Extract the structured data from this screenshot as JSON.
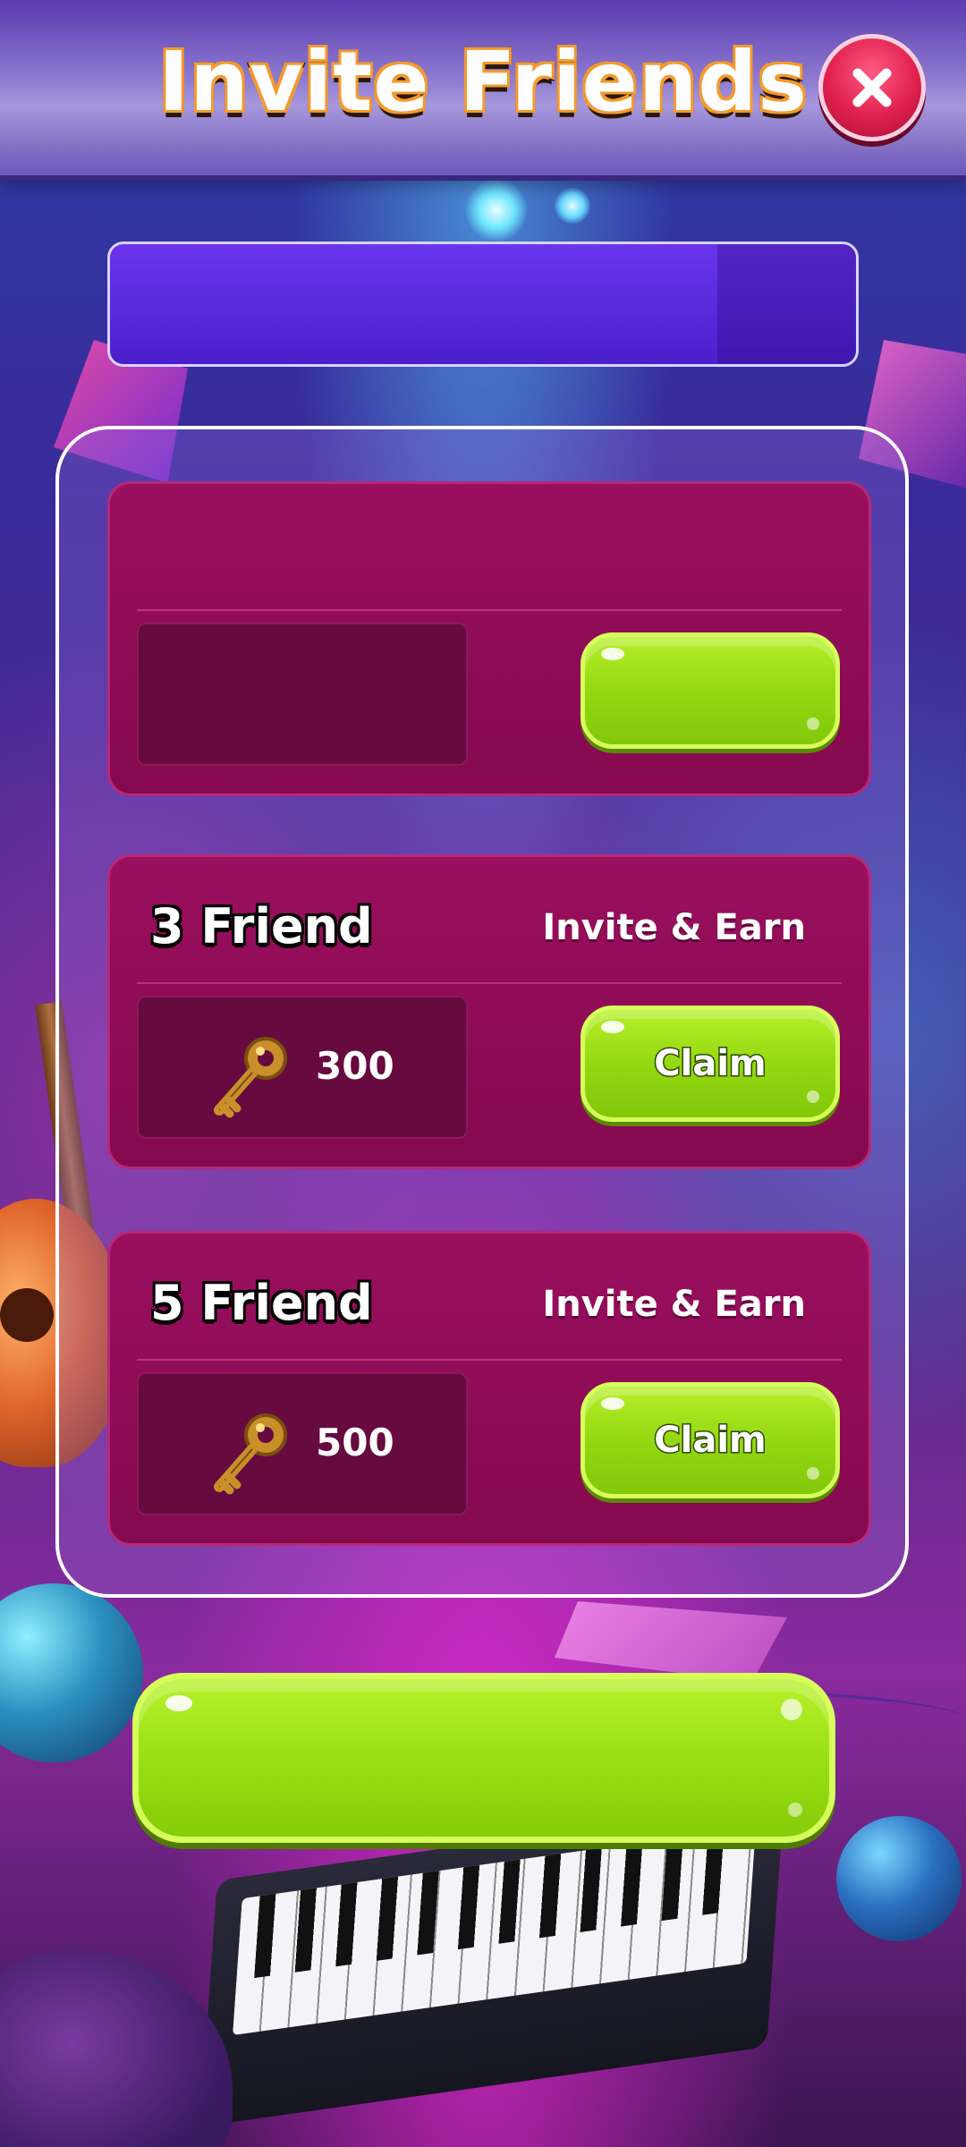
{
  "header": {
    "title": "Invite Friends",
    "close_icon": "close-icon"
  },
  "banner": {
    "text": ""
  },
  "tiers": [
    {
      "friend_label": "",
      "earn_label": "",
      "reward_icon": "key-icon",
      "reward_amount": "",
      "claim_label": ""
    },
    {
      "friend_label": "3 Friend",
      "earn_label": "Invite & Earn",
      "reward_icon": "key-icon",
      "reward_amount": "300",
      "claim_label": "Claim"
    },
    {
      "friend_label": "5 Friend",
      "earn_label": "Invite & Earn",
      "reward_icon": "key-icon",
      "reward_amount": "500",
      "claim_label": "Claim"
    }
  ],
  "bottom_button": {
    "label": ""
  },
  "colors": {
    "header": "#7a62c4",
    "card": "#920c58",
    "reward_box": "#670a3f",
    "claim_button": "#9ae014",
    "close_button": "#e0204e",
    "banner": "#5a28de"
  }
}
